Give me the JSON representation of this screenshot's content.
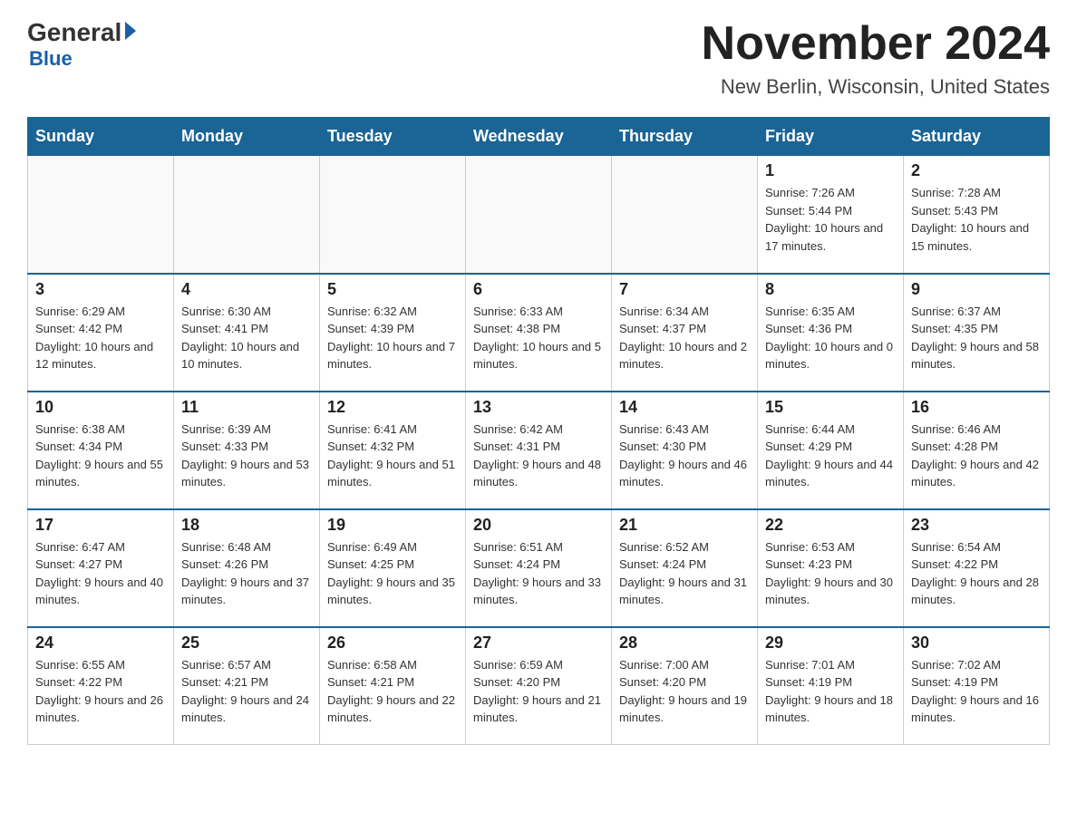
{
  "header": {
    "logo_general": "General",
    "logo_blue": "Blue",
    "title": "November 2024",
    "subtitle": "New Berlin, Wisconsin, United States"
  },
  "days_of_week": [
    "Sunday",
    "Monday",
    "Tuesday",
    "Wednesday",
    "Thursday",
    "Friday",
    "Saturday"
  ],
  "weeks": [
    [
      {
        "day": "",
        "info": ""
      },
      {
        "day": "",
        "info": ""
      },
      {
        "day": "",
        "info": ""
      },
      {
        "day": "",
        "info": ""
      },
      {
        "day": "",
        "info": ""
      },
      {
        "day": "1",
        "info": "Sunrise: 7:26 AM\nSunset: 5:44 PM\nDaylight: 10 hours and 17 minutes."
      },
      {
        "day": "2",
        "info": "Sunrise: 7:28 AM\nSunset: 5:43 PM\nDaylight: 10 hours and 15 minutes."
      }
    ],
    [
      {
        "day": "3",
        "info": "Sunrise: 6:29 AM\nSunset: 4:42 PM\nDaylight: 10 hours and 12 minutes."
      },
      {
        "day": "4",
        "info": "Sunrise: 6:30 AM\nSunset: 4:41 PM\nDaylight: 10 hours and 10 minutes."
      },
      {
        "day": "5",
        "info": "Sunrise: 6:32 AM\nSunset: 4:39 PM\nDaylight: 10 hours and 7 minutes."
      },
      {
        "day": "6",
        "info": "Sunrise: 6:33 AM\nSunset: 4:38 PM\nDaylight: 10 hours and 5 minutes."
      },
      {
        "day": "7",
        "info": "Sunrise: 6:34 AM\nSunset: 4:37 PM\nDaylight: 10 hours and 2 minutes."
      },
      {
        "day": "8",
        "info": "Sunrise: 6:35 AM\nSunset: 4:36 PM\nDaylight: 10 hours and 0 minutes."
      },
      {
        "day": "9",
        "info": "Sunrise: 6:37 AM\nSunset: 4:35 PM\nDaylight: 9 hours and 58 minutes."
      }
    ],
    [
      {
        "day": "10",
        "info": "Sunrise: 6:38 AM\nSunset: 4:34 PM\nDaylight: 9 hours and 55 minutes."
      },
      {
        "day": "11",
        "info": "Sunrise: 6:39 AM\nSunset: 4:33 PM\nDaylight: 9 hours and 53 minutes."
      },
      {
        "day": "12",
        "info": "Sunrise: 6:41 AM\nSunset: 4:32 PM\nDaylight: 9 hours and 51 minutes."
      },
      {
        "day": "13",
        "info": "Sunrise: 6:42 AM\nSunset: 4:31 PM\nDaylight: 9 hours and 48 minutes."
      },
      {
        "day": "14",
        "info": "Sunrise: 6:43 AM\nSunset: 4:30 PM\nDaylight: 9 hours and 46 minutes."
      },
      {
        "day": "15",
        "info": "Sunrise: 6:44 AM\nSunset: 4:29 PM\nDaylight: 9 hours and 44 minutes."
      },
      {
        "day": "16",
        "info": "Sunrise: 6:46 AM\nSunset: 4:28 PM\nDaylight: 9 hours and 42 minutes."
      }
    ],
    [
      {
        "day": "17",
        "info": "Sunrise: 6:47 AM\nSunset: 4:27 PM\nDaylight: 9 hours and 40 minutes."
      },
      {
        "day": "18",
        "info": "Sunrise: 6:48 AM\nSunset: 4:26 PM\nDaylight: 9 hours and 37 minutes."
      },
      {
        "day": "19",
        "info": "Sunrise: 6:49 AM\nSunset: 4:25 PM\nDaylight: 9 hours and 35 minutes."
      },
      {
        "day": "20",
        "info": "Sunrise: 6:51 AM\nSunset: 4:24 PM\nDaylight: 9 hours and 33 minutes."
      },
      {
        "day": "21",
        "info": "Sunrise: 6:52 AM\nSunset: 4:24 PM\nDaylight: 9 hours and 31 minutes."
      },
      {
        "day": "22",
        "info": "Sunrise: 6:53 AM\nSunset: 4:23 PM\nDaylight: 9 hours and 30 minutes."
      },
      {
        "day": "23",
        "info": "Sunrise: 6:54 AM\nSunset: 4:22 PM\nDaylight: 9 hours and 28 minutes."
      }
    ],
    [
      {
        "day": "24",
        "info": "Sunrise: 6:55 AM\nSunset: 4:22 PM\nDaylight: 9 hours and 26 minutes."
      },
      {
        "day": "25",
        "info": "Sunrise: 6:57 AM\nSunset: 4:21 PM\nDaylight: 9 hours and 24 minutes."
      },
      {
        "day": "26",
        "info": "Sunrise: 6:58 AM\nSunset: 4:21 PM\nDaylight: 9 hours and 22 minutes."
      },
      {
        "day": "27",
        "info": "Sunrise: 6:59 AM\nSunset: 4:20 PM\nDaylight: 9 hours and 21 minutes."
      },
      {
        "day": "28",
        "info": "Sunrise: 7:00 AM\nSunset: 4:20 PM\nDaylight: 9 hours and 19 minutes."
      },
      {
        "day": "29",
        "info": "Sunrise: 7:01 AM\nSunset: 4:19 PM\nDaylight: 9 hours and 18 minutes."
      },
      {
        "day": "30",
        "info": "Sunrise: 7:02 AM\nSunset: 4:19 PM\nDaylight: 9 hours and 16 minutes."
      }
    ]
  ]
}
